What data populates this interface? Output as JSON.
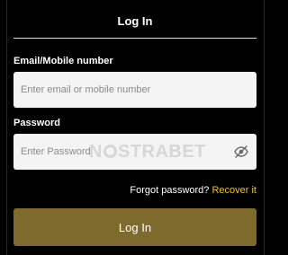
{
  "dialog": {
    "title": "Log In"
  },
  "form": {
    "email": {
      "label": "Email/Mobile number",
      "placeholder": "Enter email or mobile number",
      "value": ""
    },
    "password": {
      "label": "Password",
      "placeholder": "Enter Password",
      "value": "",
      "visibility_icon": "eye-slash-icon"
    },
    "forgot": {
      "text": "Forgot password?",
      "link_label": "Recover it"
    },
    "submit_label": "Log In"
  },
  "watermark": {
    "text": "NOSTRABET"
  },
  "colors": {
    "background": "#000000",
    "input_background": "#f4f4f4",
    "accent_link": "#f0c419",
    "button_background": "#7e6a2c",
    "divider": "#d9d9d9"
  }
}
